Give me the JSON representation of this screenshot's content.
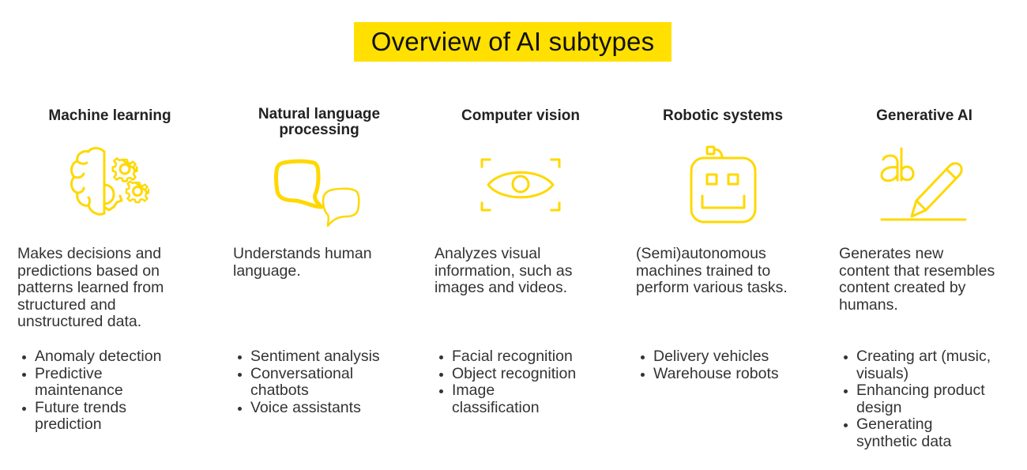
{
  "title": "Overview of AI subtypes",
  "colors": {
    "accent": "#FFE000",
    "icon_stroke": "#FFD800",
    "text": "#222222"
  },
  "columns": [
    {
      "heading": "Machine learning",
      "icon": "brain-gears-icon",
      "description": "Makes decisions and predictions based on patterns learned from structured and unstructured data.",
      "bullets": [
        "Anomaly detection",
        "Predictive maintenance",
        "Future trends prediction"
      ]
    },
    {
      "heading": "Natural language processing",
      "icon": "speech-bubbles-icon",
      "description": "Understands human language.",
      "bullets": [
        "Sentiment analysis",
        "Conversational chatbots",
        "Voice assistants"
      ]
    },
    {
      "heading": "Computer vision",
      "icon": "eye-scan-icon",
      "description": "Analyzes visual information, such as images and videos.",
      "bullets": [
        "Facial recognition",
        "Object recognition",
        "Image classification"
      ]
    },
    {
      "heading": "Robotic systems",
      "icon": "robot-face-icon",
      "description": "(Semi)autonomous machines trained to perform various tasks.",
      "bullets": [
        "Delivery vehicles",
        "Warehouse robots"
      ]
    },
    {
      "heading": "Generative AI",
      "icon": "ab-pencil-icon",
      "description": "Generates new content that resembles content created by humans.",
      "bullets": [
        "Creating art (music, visuals)",
        "Enhancing product design",
        "Generating synthetic data"
      ]
    }
  ]
}
